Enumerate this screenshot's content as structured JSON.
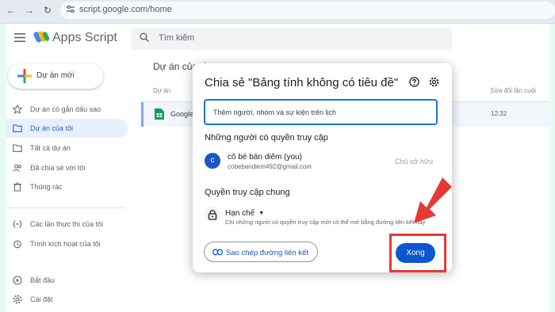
{
  "browser": {
    "url": "script.google.com/home"
  },
  "app": {
    "title": "Apps Script",
    "search_placeholder": "Tìm kiếm"
  },
  "sidebar": {
    "new_project": "Dự án mới",
    "items": [
      {
        "label": "Dự án có gắn dấu sao",
        "icon": "star-icon"
      },
      {
        "label": "Dự án của tôi",
        "icon": "folder-icon",
        "active": true
      },
      {
        "label": "Tất cả dự án",
        "icon": "folder-outline-icon"
      },
      {
        "label": "Đã chia sẻ với tôi",
        "icon": "people-icon"
      },
      {
        "label": "Thùng rác",
        "icon": "trash-icon"
      },
      {
        "label": "Các lần thực thi của tôi",
        "icon": "executions-icon"
      },
      {
        "label": "Trình kích hoạt của tôi",
        "icon": "alarm-icon"
      },
      {
        "label": "Bắt đầu",
        "icon": "play-icon"
      },
      {
        "label": "Cài đặt",
        "icon": "settings-icon"
      }
    ]
  },
  "main": {
    "heading": "Dự án của tô",
    "columns": {
      "project": "Dự án",
      "modified": "Sửa đổi lần cuối"
    },
    "row": {
      "name": "Google",
      "time": "12:32"
    }
  },
  "dialog": {
    "title": "Chia sẻ \"Bảng tính không có tiêu đề\"",
    "add_people_placeholder": "Thêm người, nhóm và sự kiện trên lịch",
    "people_section": "Những người có quyền truy cập",
    "person": {
      "initial": "c",
      "name": "cô bé bán diêm (you)",
      "email": "cobebandiem492@gmail.com",
      "role": "Chủ sở hữu"
    },
    "general_access_section": "Quyền truy cập chung",
    "access_level": "Hạn chế",
    "access_desc": "Chỉ những người có quyền truy cập mới có thể mở bằng đường liên kết này",
    "copy_link": "Sao chép đường liên kết",
    "done": "Xong"
  },
  "colors": {
    "accent": "#0b57d0",
    "annotation": "#e53935",
    "background_frame": "#e6fbf4"
  }
}
